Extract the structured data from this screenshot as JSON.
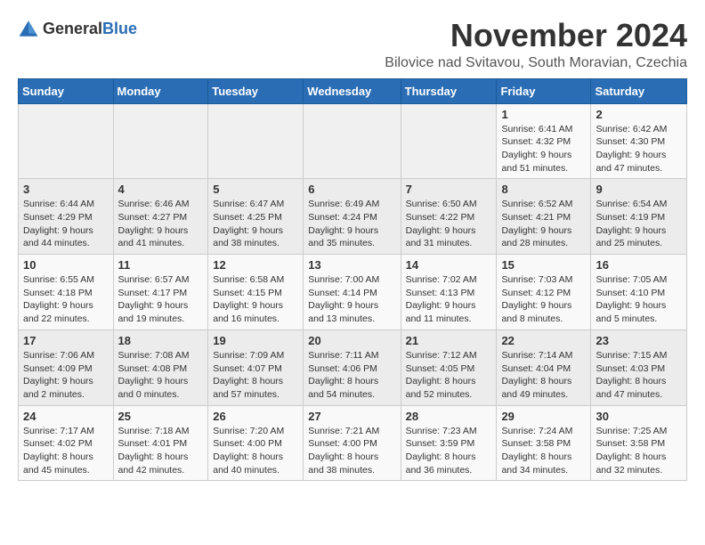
{
  "logo": {
    "general": "General",
    "blue": "Blue"
  },
  "title": "November 2024",
  "subtitle": "Bilovice nad Svitavou, South Moravian, Czechia",
  "weekdays": [
    "Sunday",
    "Monday",
    "Tuesday",
    "Wednesday",
    "Thursday",
    "Friday",
    "Saturday"
  ],
  "rows": [
    [
      {
        "day": "",
        "sunrise": "",
        "sunset": "",
        "daylight": ""
      },
      {
        "day": "",
        "sunrise": "",
        "sunset": "",
        "daylight": ""
      },
      {
        "day": "",
        "sunrise": "",
        "sunset": "",
        "daylight": ""
      },
      {
        "day": "",
        "sunrise": "",
        "sunset": "",
        "daylight": ""
      },
      {
        "day": "",
        "sunrise": "",
        "sunset": "",
        "daylight": ""
      },
      {
        "day": "1",
        "sunrise": "Sunrise: 6:41 AM",
        "sunset": "Sunset: 4:32 PM",
        "daylight": "Daylight: 9 hours and 51 minutes."
      },
      {
        "day": "2",
        "sunrise": "Sunrise: 6:42 AM",
        "sunset": "Sunset: 4:30 PM",
        "daylight": "Daylight: 9 hours and 47 minutes."
      }
    ],
    [
      {
        "day": "3",
        "sunrise": "Sunrise: 6:44 AM",
        "sunset": "Sunset: 4:29 PM",
        "daylight": "Daylight: 9 hours and 44 minutes."
      },
      {
        "day": "4",
        "sunrise": "Sunrise: 6:46 AM",
        "sunset": "Sunset: 4:27 PM",
        "daylight": "Daylight: 9 hours and 41 minutes."
      },
      {
        "day": "5",
        "sunrise": "Sunrise: 6:47 AM",
        "sunset": "Sunset: 4:25 PM",
        "daylight": "Daylight: 9 hours and 38 minutes."
      },
      {
        "day": "6",
        "sunrise": "Sunrise: 6:49 AM",
        "sunset": "Sunset: 4:24 PM",
        "daylight": "Daylight: 9 hours and 35 minutes."
      },
      {
        "day": "7",
        "sunrise": "Sunrise: 6:50 AM",
        "sunset": "Sunset: 4:22 PM",
        "daylight": "Daylight: 9 hours and 31 minutes."
      },
      {
        "day": "8",
        "sunrise": "Sunrise: 6:52 AM",
        "sunset": "Sunset: 4:21 PM",
        "daylight": "Daylight: 9 hours and 28 minutes."
      },
      {
        "day": "9",
        "sunrise": "Sunrise: 6:54 AM",
        "sunset": "Sunset: 4:19 PM",
        "daylight": "Daylight: 9 hours and 25 minutes."
      }
    ],
    [
      {
        "day": "10",
        "sunrise": "Sunrise: 6:55 AM",
        "sunset": "Sunset: 4:18 PM",
        "daylight": "Daylight: 9 hours and 22 minutes."
      },
      {
        "day": "11",
        "sunrise": "Sunrise: 6:57 AM",
        "sunset": "Sunset: 4:17 PM",
        "daylight": "Daylight: 9 hours and 19 minutes."
      },
      {
        "day": "12",
        "sunrise": "Sunrise: 6:58 AM",
        "sunset": "Sunset: 4:15 PM",
        "daylight": "Daylight: 9 hours and 16 minutes."
      },
      {
        "day": "13",
        "sunrise": "Sunrise: 7:00 AM",
        "sunset": "Sunset: 4:14 PM",
        "daylight": "Daylight: 9 hours and 13 minutes."
      },
      {
        "day": "14",
        "sunrise": "Sunrise: 7:02 AM",
        "sunset": "Sunset: 4:13 PM",
        "daylight": "Daylight: 9 hours and 11 minutes."
      },
      {
        "day": "15",
        "sunrise": "Sunrise: 7:03 AM",
        "sunset": "Sunset: 4:12 PM",
        "daylight": "Daylight: 9 hours and 8 minutes."
      },
      {
        "day": "16",
        "sunrise": "Sunrise: 7:05 AM",
        "sunset": "Sunset: 4:10 PM",
        "daylight": "Daylight: 9 hours and 5 minutes."
      }
    ],
    [
      {
        "day": "17",
        "sunrise": "Sunrise: 7:06 AM",
        "sunset": "Sunset: 4:09 PM",
        "daylight": "Daylight: 9 hours and 2 minutes."
      },
      {
        "day": "18",
        "sunrise": "Sunrise: 7:08 AM",
        "sunset": "Sunset: 4:08 PM",
        "daylight": "Daylight: 9 hours and 0 minutes."
      },
      {
        "day": "19",
        "sunrise": "Sunrise: 7:09 AM",
        "sunset": "Sunset: 4:07 PM",
        "daylight": "Daylight: 8 hours and 57 minutes."
      },
      {
        "day": "20",
        "sunrise": "Sunrise: 7:11 AM",
        "sunset": "Sunset: 4:06 PM",
        "daylight": "Daylight: 8 hours and 54 minutes."
      },
      {
        "day": "21",
        "sunrise": "Sunrise: 7:12 AM",
        "sunset": "Sunset: 4:05 PM",
        "daylight": "Daylight: 8 hours and 52 minutes."
      },
      {
        "day": "22",
        "sunrise": "Sunrise: 7:14 AM",
        "sunset": "Sunset: 4:04 PM",
        "daylight": "Daylight: 8 hours and 49 minutes."
      },
      {
        "day": "23",
        "sunrise": "Sunrise: 7:15 AM",
        "sunset": "Sunset: 4:03 PM",
        "daylight": "Daylight: 8 hours and 47 minutes."
      }
    ],
    [
      {
        "day": "24",
        "sunrise": "Sunrise: 7:17 AM",
        "sunset": "Sunset: 4:02 PM",
        "daylight": "Daylight: 8 hours and 45 minutes."
      },
      {
        "day": "25",
        "sunrise": "Sunrise: 7:18 AM",
        "sunset": "Sunset: 4:01 PM",
        "daylight": "Daylight: 8 hours and 42 minutes."
      },
      {
        "day": "26",
        "sunrise": "Sunrise: 7:20 AM",
        "sunset": "Sunset: 4:00 PM",
        "daylight": "Daylight: 8 hours and 40 minutes."
      },
      {
        "day": "27",
        "sunrise": "Sunrise: 7:21 AM",
        "sunset": "Sunset: 4:00 PM",
        "daylight": "Daylight: 8 hours and 38 minutes."
      },
      {
        "day": "28",
        "sunrise": "Sunrise: 7:23 AM",
        "sunset": "Sunset: 3:59 PM",
        "daylight": "Daylight: 8 hours and 36 minutes."
      },
      {
        "day": "29",
        "sunrise": "Sunrise: 7:24 AM",
        "sunset": "Sunset: 3:58 PM",
        "daylight": "Daylight: 8 hours and 34 minutes."
      },
      {
        "day": "30",
        "sunrise": "Sunrise: 7:25 AM",
        "sunset": "Sunset: 3:58 PM",
        "daylight": "Daylight: 8 hours and 32 minutes."
      }
    ]
  ]
}
